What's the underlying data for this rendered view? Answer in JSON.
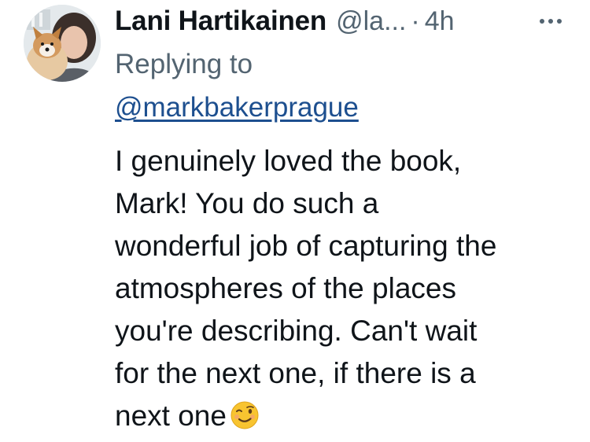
{
  "tweet": {
    "author": {
      "display_name": "Lani Hartikainen",
      "handle": "@la...",
      "avatar_icon": "profile-photo-with-dog"
    },
    "separator": "·",
    "time": "4h",
    "more_icon": "more-horizontal-icon",
    "replying_label": "Replying to",
    "reply_to": "@markbakerprague",
    "lines": [
      "I genuinely loved the book,",
      "Mark! You do such a",
      "wonderful job of capturing the",
      "atmospheres of the places",
      "you're describing. Can't wait",
      "for the next one, if there is a",
      "next one"
    ],
    "emoji_icon": "winking-face-emoji"
  },
  "colors": {
    "text": "#0f1419",
    "secondary": "#536471",
    "link": "#1d4f8f",
    "emoji": "#f8c430"
  }
}
